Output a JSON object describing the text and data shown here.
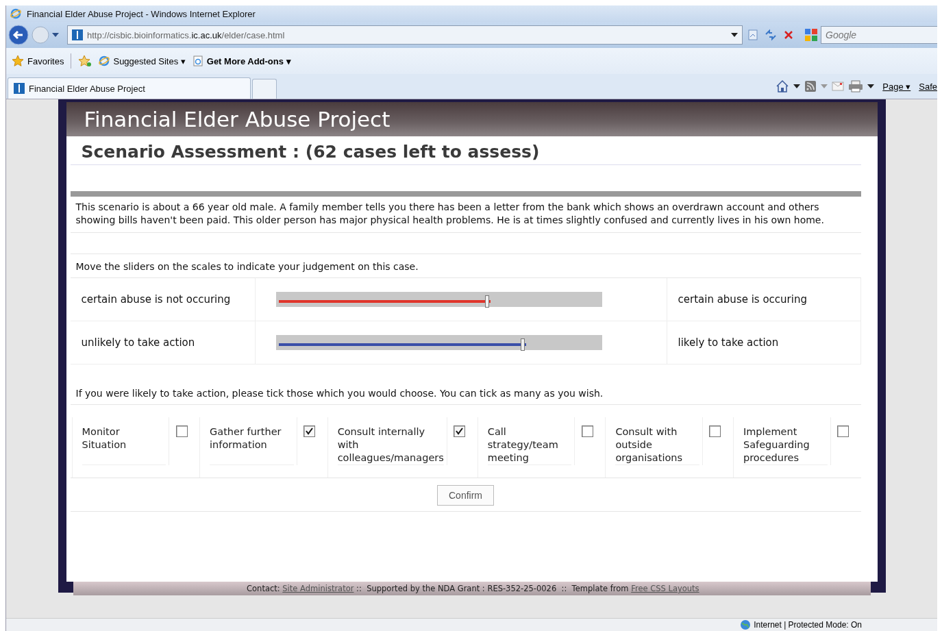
{
  "window": {
    "title": "Financial Elder Abuse Project - Windows Internet Explorer"
  },
  "address_bar": {
    "url": "http://cisbic.bioinformatics.**ic.ac.uk**/elder/case.html",
    "search_placeholder": "Google"
  },
  "favorites_bar": {
    "items": [
      {
        "label": "Favorites",
        "kind": "favorites"
      },
      {
        "label": "Suggested Sites ▾",
        "kind": "suggested"
      },
      {
        "label": "Get More Add-ons ▾",
        "kind": "addons"
      }
    ]
  },
  "tabs": [
    {
      "label": "Financial Elder Abuse Project",
      "selected": true
    }
  ],
  "command_bar": {
    "items": [
      "Page ▾",
      "Safe"
    ]
  },
  "page": {
    "title": "Financial Elder Abuse Project",
    "subtitle": "Scenario Assessment : (62 cases left to assess)",
    "scenario": "This scenario is about a 66 year old male. A family member tells you there has been a letter from the bank which shows an overdrawn account and others showing bills haven't been paid. This older person has major physical health problems. He is at times slightly confused and currently lives in his own home.",
    "slider_instruction": "Move the sliders on the scales to indicate your judgement on this case.",
    "sliders": [
      {
        "left_label": "certain abuse is not occuring",
        "right_label": "certain abuse is occuring",
        "level": 0.65,
        "color": "#e0352b"
      },
      {
        "left_label": "unlikely to take action",
        "right_label": "likely to take action",
        "level": 0.76,
        "color": "#3a4fa8"
      }
    ],
    "options_instruction": "If you were likely to take action, please tick those which you would choose. You can tick as many as you wish.",
    "options": [
      {
        "label": "Monitor Situation",
        "checked": false
      },
      {
        "label": "Gather further information",
        "checked": true
      },
      {
        "label": "Consult internally with colleagues/managers",
        "checked": true
      },
      {
        "label": "Call strategy/team meeting",
        "checked": false
      },
      {
        "label": "Consult with outside organisations",
        "checked": false
      },
      {
        "label": "Implement Safeguarding procedures",
        "checked": false
      }
    ],
    "confirm_button": "Confirm",
    "footer": [
      {
        "kind": "text",
        "text": "Contact:"
      },
      {
        "kind": "link",
        "text": "Site Administrator"
      },
      {
        "kind": "text",
        "text": "::  Supported by the NDA Grant : RES-352-25-0026  ::  Template from"
      },
      {
        "kind": "link",
        "text": "Free CSS Layouts"
      }
    ]
  },
  "status_bar": {
    "zone": "Internet | Protected Mode: On"
  }
}
